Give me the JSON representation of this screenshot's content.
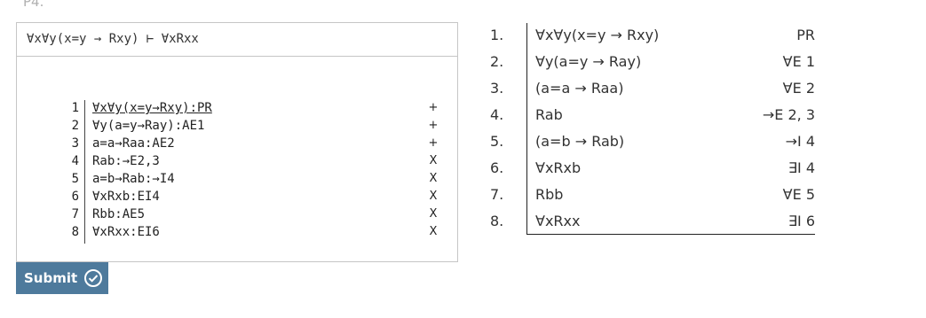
{
  "problem_label": "P4.",
  "editor": {
    "goal": "∀x∀y(x=y → Rxy) ⊢ ∀xRxx",
    "lines": [
      {
        "num": "1",
        "text": "∀x∀y(x=y→Rxy):PR",
        "mark": "+"
      },
      {
        "num": "2",
        "text": "∀y(a=y→Ray):AE1",
        "mark": "+"
      },
      {
        "num": "3",
        "text": "a=a→Raa:AE2",
        "mark": "+"
      },
      {
        "num": "4",
        "text": "Rab:→E2,3",
        "mark": "X"
      },
      {
        "num": "5",
        "text": "a=b→Rab:→I4",
        "mark": "X"
      },
      {
        "num": "6",
        "text": "∀xRxb:EI4",
        "mark": "X"
      },
      {
        "num": "7",
        "text": "Rbb:AE5",
        "mark": "X"
      },
      {
        "num": "8",
        "text": "∀xRxx:EI6",
        "mark": "X"
      }
    ]
  },
  "submit": {
    "label": "Submit"
  },
  "proof": {
    "rows": [
      {
        "num": "1.",
        "formula": "∀x∀y(x=y → Rxy)",
        "just": "PR"
      },
      {
        "num": "2.",
        "formula": "∀y(a=y → Ray)",
        "just": "∀E 1"
      },
      {
        "num": "3.",
        "formula": "(a=a → Raa)",
        "just": "∀E 2"
      },
      {
        "num": "4.",
        "formula": "Rab",
        "just": "→E 2, 3"
      },
      {
        "num": "5.",
        "formula": "(a=b → Rab)",
        "just": "→I 4"
      },
      {
        "num": "6.",
        "formula": "∀xRxb",
        "just": "∃I 4"
      },
      {
        "num": "7.",
        "formula": "Rbb",
        "just": "∀E 5"
      },
      {
        "num": "8.",
        "formula": "∀xRxx",
        "just": "∃I 6"
      }
    ]
  }
}
